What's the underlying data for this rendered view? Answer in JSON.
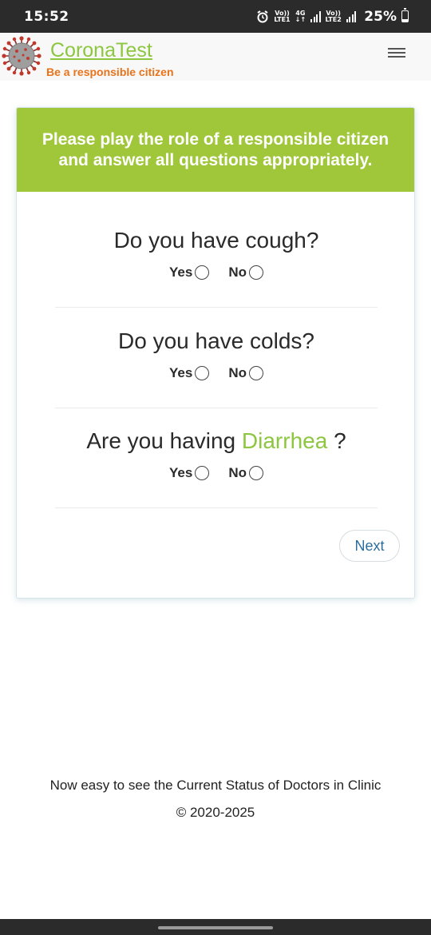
{
  "status_bar": {
    "time": "15:52",
    "sim1_top": "Vo))",
    "sim1_bottom": "LTE1",
    "network_top": "4G",
    "network_bottom": "↓↑",
    "sim2_top": "Vo))",
    "sim2_bottom": "LTE2",
    "battery_percent": "25%",
    "battery_level": 0.25
  },
  "header": {
    "brand_title": "CoronaTest",
    "tagline": "Be a responsible citizen",
    "menu_icon": "hamburger-icon"
  },
  "card": {
    "banner": "Please play the role of a responsible citizen and answer all questions appropriately.",
    "questions": [
      {
        "text": "Do you have cough?",
        "yes_label": "Yes",
        "no_label": "No"
      },
      {
        "text": "Do you have colds?",
        "yes_label": "Yes",
        "no_label": "No"
      },
      {
        "text_before": "Are you having ",
        "highlight": "Diarrhea",
        "text_after": " ?",
        "yes_label": "Yes",
        "no_label": "No"
      }
    ],
    "next_label": "Next"
  },
  "footer": {
    "line1": "Now easy to see the Current Status of Doctors in Clinic",
    "line2": "© 2020-2025"
  },
  "colors": {
    "brand_green": "#8dc63f",
    "banner_green": "#a0c73a",
    "tagline_orange": "#e8731b",
    "link_blue": "#2d6d9c"
  }
}
